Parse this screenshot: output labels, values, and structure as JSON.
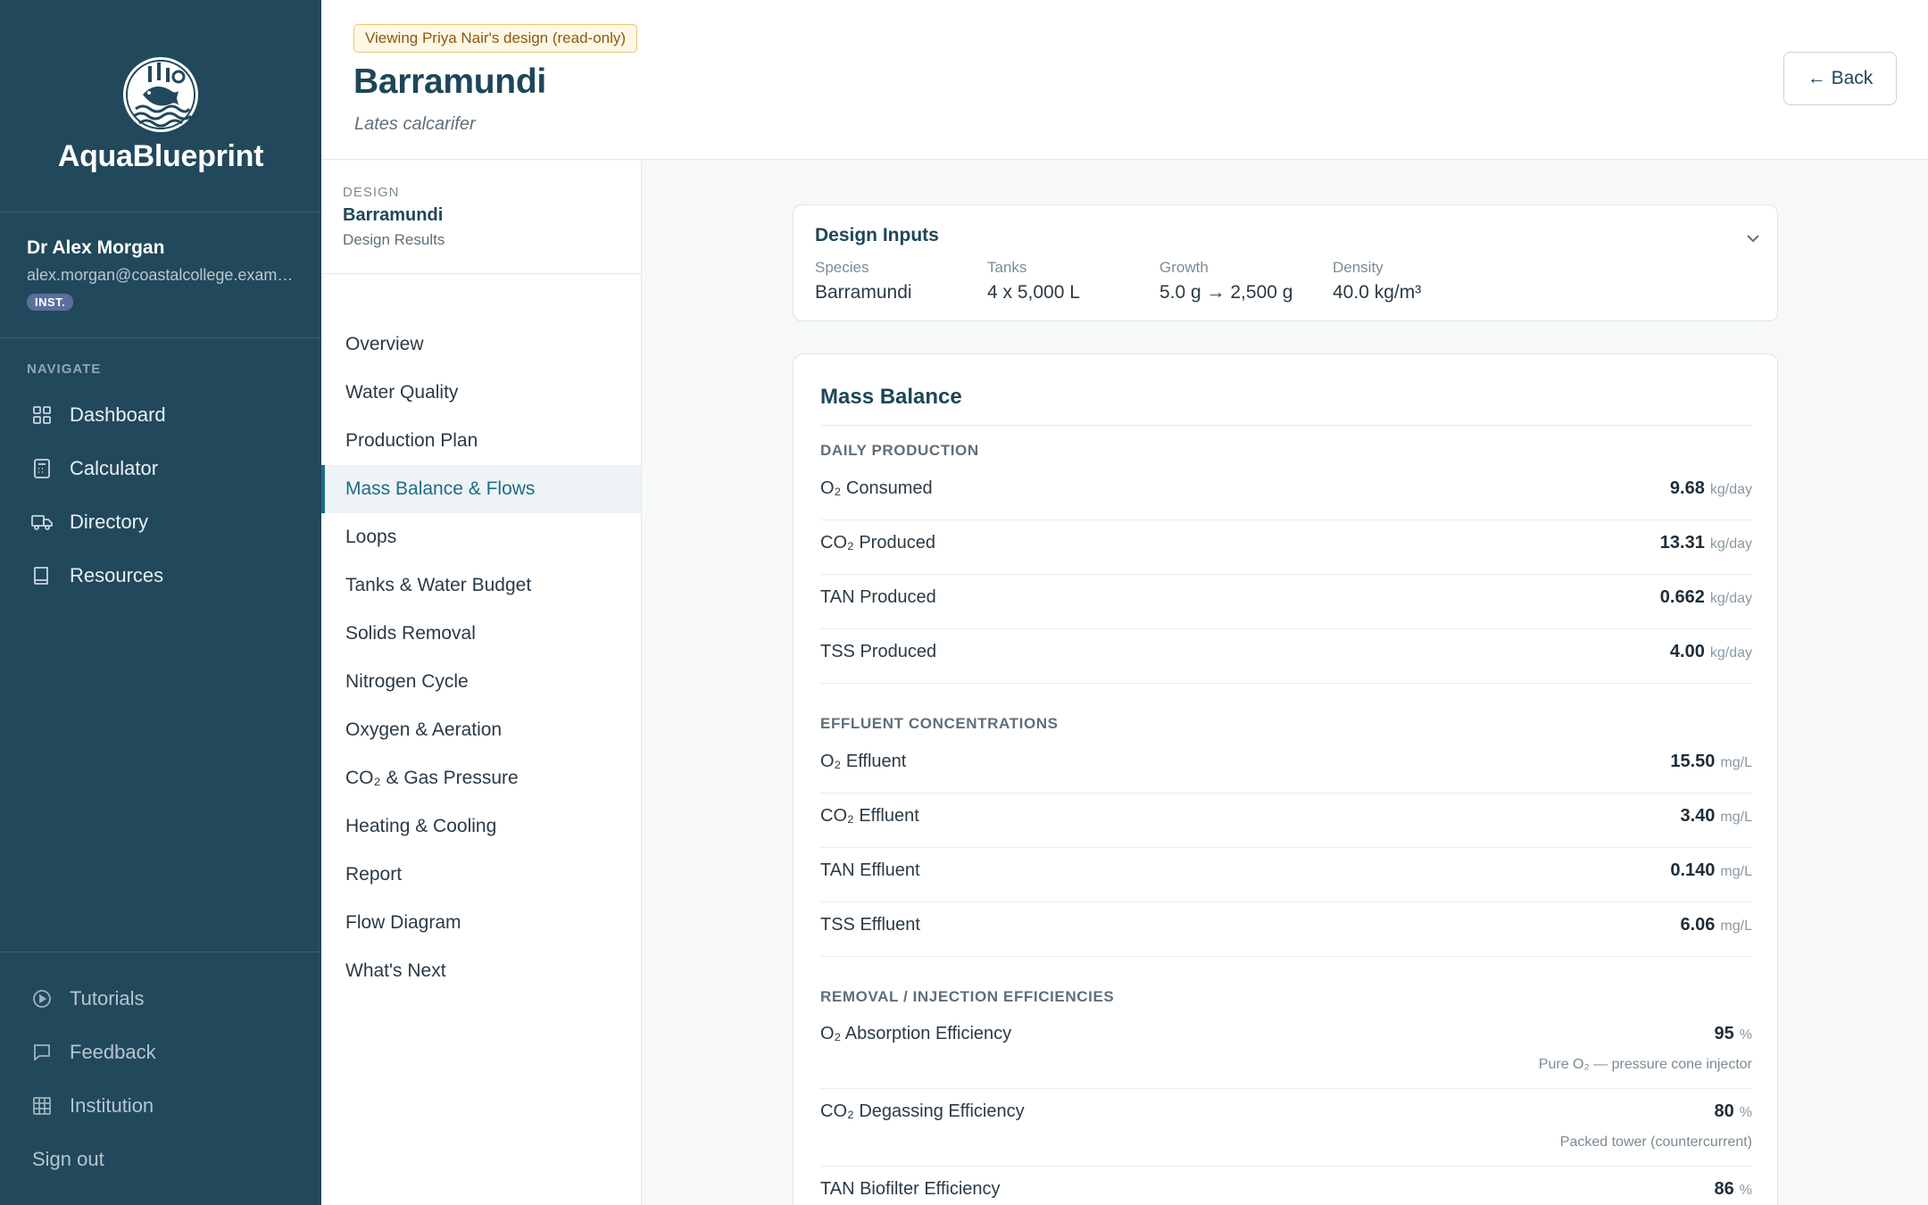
{
  "brand": {
    "name": "AquaBlueprint"
  },
  "user": {
    "name": "Dr Alex Morgan",
    "email": "alex.morgan@coastalcollege.exam…",
    "badge": "INST."
  },
  "nav": {
    "heading": "NAVIGATE",
    "items": [
      {
        "label": "Dashboard",
        "icon": "grid-icon"
      },
      {
        "label": "Calculator",
        "icon": "calculator-icon"
      },
      {
        "label": "Directory",
        "icon": "truck-icon"
      },
      {
        "label": "Resources",
        "icon": "book-icon"
      }
    ],
    "bottom": [
      {
        "label": "Tutorials",
        "icon": "play-circle-icon"
      },
      {
        "label": "Feedback",
        "icon": "message-icon"
      },
      {
        "label": "Institution",
        "icon": "building-grid-icon"
      }
    ],
    "signout": "Sign out"
  },
  "header": {
    "banner": "Viewing Priya Nair's design (read-only)",
    "title": "Barramundi",
    "subtitle": "Lates calcarifer",
    "back_label": "← Back"
  },
  "section_nav": {
    "label": "DESIGN",
    "title": "Barramundi",
    "subtitle": "Design Results",
    "active_index": 3,
    "items": [
      "Overview",
      "Water Quality",
      "Production Plan",
      "Mass Balance & Flows",
      "Loops",
      "Tanks & Water Budget",
      "Solids Removal",
      "Nitrogen Cycle",
      "Oxygen & Aeration",
      "CO₂ & Gas Pressure",
      "Heating & Cooling",
      "Report",
      "Flow Diagram",
      "What's Next"
    ]
  },
  "design_inputs": {
    "title": "Design Inputs",
    "fields": [
      {
        "label": "Species",
        "value": "Barramundi"
      },
      {
        "label": "Tanks",
        "value": "4 x 5,000 L"
      },
      {
        "label": "Growth",
        "value": "5.0 g → 2,500 g"
      },
      {
        "label": "Density",
        "value": "40.0 kg/m³"
      }
    ]
  },
  "mass_balance": {
    "title": "Mass Balance",
    "daily_production": {
      "heading": "DAILY PRODUCTION",
      "rows": [
        {
          "label": "O₂ Consumed",
          "value": "9.68",
          "unit": "kg/day"
        },
        {
          "label": "CO₂ Produced",
          "value": "13.31",
          "unit": "kg/day"
        },
        {
          "label": "TAN Produced",
          "value": "0.662",
          "unit": "kg/day"
        },
        {
          "label": "TSS Produced",
          "value": "4.00",
          "unit": "kg/day"
        }
      ]
    },
    "effluent": {
      "heading": "EFFLUENT CONCENTRATIONS",
      "rows": [
        {
          "label": "O₂ Effluent",
          "value": "15.50",
          "unit": "mg/L"
        },
        {
          "label": "CO₂ Effluent",
          "value": "3.40",
          "unit": "mg/L"
        },
        {
          "label": "TAN Effluent",
          "value": "0.140",
          "unit": "mg/L"
        },
        {
          "label": "TSS Effluent",
          "value": "6.06",
          "unit": "mg/L"
        }
      ]
    },
    "efficiencies": {
      "heading": "REMOVAL / INJECTION EFFICIENCIES",
      "rows": [
        {
          "label": "O₂ Absorption Efficiency",
          "value": "95",
          "unit": "%",
          "note": "Pure O₂ — pressure cone injector"
        },
        {
          "label": "CO₂ Degassing Efficiency",
          "value": "80",
          "unit": "%",
          "note": "Packed tower (countercurrent)"
        },
        {
          "label": "TAN Biofilter Efficiency",
          "value": "86",
          "unit": "%",
          "note": ""
        }
      ]
    }
  },
  "colors": {
    "sidebar": "#22485b",
    "accent": "#1f6b88",
    "title": "#1e4659",
    "banner_bg": "#fdf7e5",
    "banner_border": "#e8c66c"
  }
}
